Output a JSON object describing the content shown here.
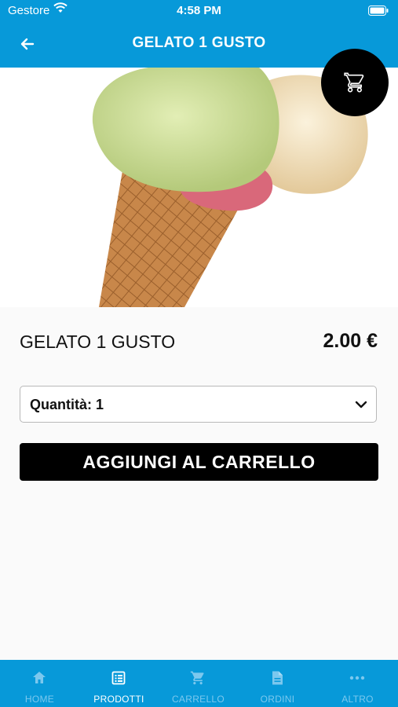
{
  "status_bar": {
    "carrier": "Gestore",
    "time": "4:58 PM"
  },
  "nav": {
    "title": "GELATO 1 GUSTO"
  },
  "product": {
    "name": "GELATO 1 GUSTO",
    "price": "2.00 €",
    "quantity_label": "Quantità: 1",
    "add_button_label": "AGGIUNGI AL CARRELLO"
  },
  "tabs": [
    {
      "label": "HOME",
      "icon": "home-icon",
      "active": false
    },
    {
      "label": "PRODOTTI",
      "icon": "list-icon",
      "active": true
    },
    {
      "label": "CARRELLO",
      "icon": "cart-icon",
      "active": false
    },
    {
      "label": "ORDINI",
      "icon": "document-icon",
      "active": false
    },
    {
      "label": "ALTRO",
      "icon": "more-icon",
      "active": false
    }
  ],
  "colors": {
    "brand": "#0799d9",
    "button": "#000000",
    "tab_inactive": "#7cc8ee",
    "tab_active": "#ffffff"
  }
}
